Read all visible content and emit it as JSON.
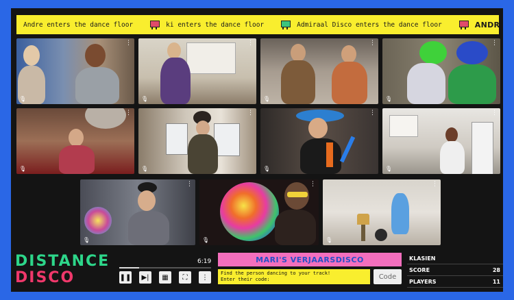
{
  "ticker": [
    {
      "text": "Andre enters the dance floor",
      "bold": false
    },
    {
      "text": "ki enters the dance floor",
      "bold": false
    },
    {
      "text": "Admiraal Disco enters the dance floor",
      "bold": false
    },
    {
      "text": "ANDRE AND JOSJE ARE DANCING!",
      "bold": true
    }
  ],
  "player": {
    "time": "6:19",
    "progress": 0.22
  },
  "logo": {
    "line1": "DISTANCE",
    "line2": "DISCO"
  },
  "party": {
    "title": "MARI'S VERJAARSDISCO",
    "prompt_line1": "Find the person dancing to your track!",
    "prompt_line2": "Enter their code:",
    "code_placeholder": "Code"
  },
  "stats": [
    {
      "label": "KLASIEN",
      "value": ""
    },
    {
      "label": "SCORE",
      "value": "28"
    },
    {
      "label": "PLAYERS",
      "value": "11"
    }
  ],
  "colors": {
    "page_bg": "#2a67e6",
    "ticker_bg": "#f9ee2e",
    "logo_green": "#2dd68a",
    "logo_pink": "#f0386b",
    "title_bg": "#f36fbd",
    "title_text": "#2850c8"
  },
  "icons": {
    "pause": "pause-icon",
    "next": "skip-next-icon",
    "grid": "grid-view-icon",
    "fullscreen": "fullscreen-icon",
    "menu": "more-vertical-icon"
  }
}
